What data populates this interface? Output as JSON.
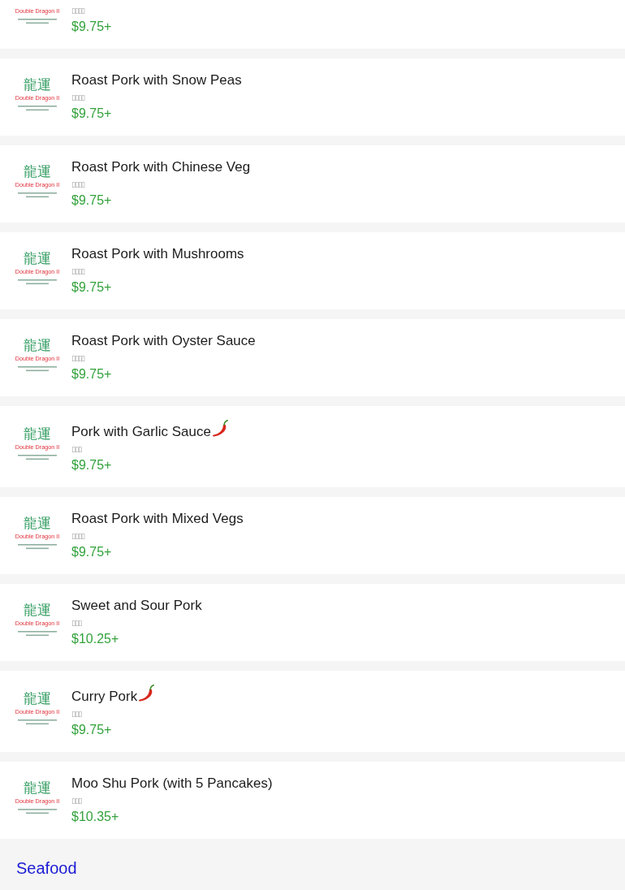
{
  "menu_items": [
    {
      "logo": {
        "name": "Double Dragon II"
      },
      "secondary_name": "▯▯▯▯",
      "price": "$9.75+",
      "spicy": false
    },
    {
      "name": "Roast Pork with Snow Peas",
      "logo": {
        "mark": "龍運",
        "name": "Double Dragon II"
      },
      "secondary_name": "▯▯▯▯",
      "price": "$9.75+",
      "spicy": false
    },
    {
      "name": "Roast Pork with Chinese Veg",
      "logo": {
        "mark": "龍運",
        "name": "Double Dragon II"
      },
      "secondary_name": "▯▯▯▯",
      "price": "$9.75+",
      "spicy": false
    },
    {
      "name": "Roast Pork with Mushrooms",
      "logo": {
        "mark": "龍運",
        "name": "Double Dragon II"
      },
      "secondary_name": "▯▯▯▯",
      "price": "$9.75+",
      "spicy": false
    },
    {
      "name": "Roast Pork with Oyster Sauce",
      "logo": {
        "mark": "龍運",
        "name": "Double Dragon II"
      },
      "secondary_name": "▯▯▯▯",
      "price": "$9.75+",
      "spicy": false
    },
    {
      "name": "Pork with Garlic Sauce",
      "logo": {
        "mark": "龍運",
        "name": "Double Dragon II"
      },
      "secondary_name": "▯▯▯",
      "price": "$9.75+",
      "spicy": true
    },
    {
      "name": "Roast Pork with Mixed Vegs",
      "logo": {
        "mark": "龍運",
        "name": "Double Dragon II"
      },
      "secondary_name": "▯▯▯▯",
      "price": "$9.75+",
      "spicy": false
    },
    {
      "name": "Sweet and Sour Pork",
      "logo": {
        "mark": "龍運",
        "name": "Double Dragon II"
      },
      "secondary_name": "▯▯▯",
      "price": "$10.25+",
      "spicy": false
    },
    {
      "name": "Curry Pork",
      "logo": {
        "mark": "龍運",
        "name": "Double Dragon II"
      },
      "secondary_name": "▯▯▯",
      "price": "$9.75+",
      "spicy": true
    },
    {
      "name": "Moo Shu Pork (with 5 Pancakes)",
      "logo": {
        "mark": "龍運",
        "name": "Double Dragon II"
      },
      "secondary_name": "▯▯▯",
      "price": "$10.35+",
      "spicy": false
    }
  ],
  "section": {
    "title": "Seafood"
  }
}
